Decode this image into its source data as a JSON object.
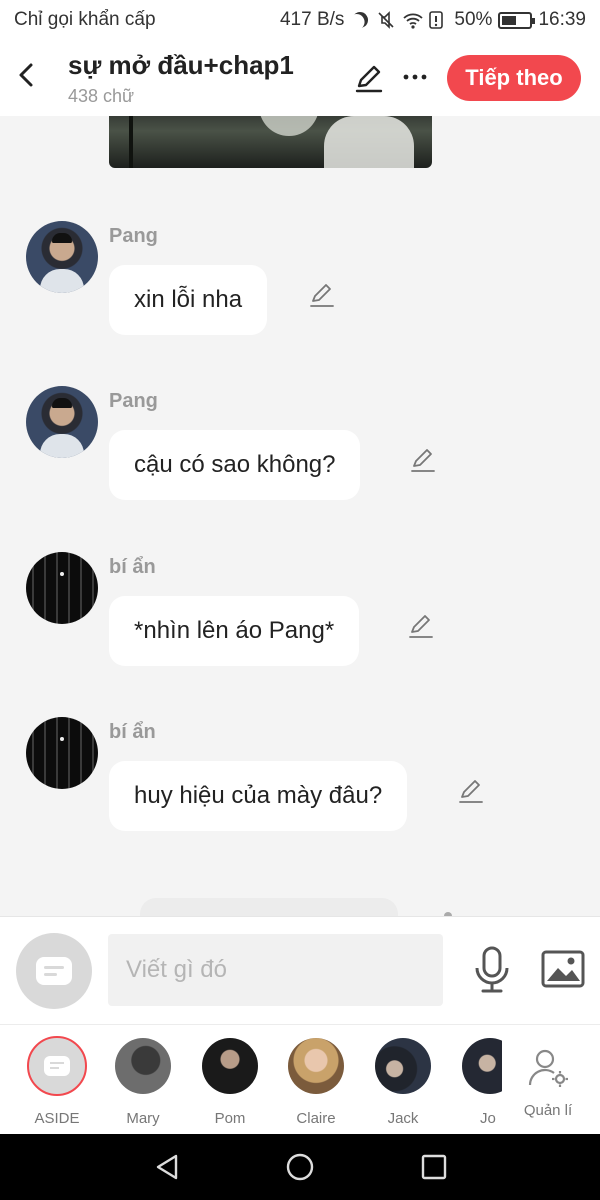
{
  "status_bar": {
    "carrier": "Chỉ gọi khẩn cấp",
    "speed": "417 B/s",
    "battery_pct": "50%",
    "time": "16:39"
  },
  "header": {
    "title": "sự mở đầu+chap1",
    "word_count": "438 chữ",
    "next_label": "Tiếp theo"
  },
  "messages": [
    {
      "sender": "Pang",
      "text": "xin lỗi nha",
      "avatar": "pang"
    },
    {
      "sender": "Pang",
      "text": "cậu có sao không?",
      "avatar": "pang"
    },
    {
      "sender": "bí ẩn",
      "text": "*nhìn lên áo Pang*",
      "avatar": "bian"
    },
    {
      "sender": "bí ẩn",
      "text": "huy hiệu của mày đâu?",
      "avatar": "bian"
    }
  ],
  "composer": {
    "placeholder": "Viết gì đó"
  },
  "characters": [
    {
      "label": "ASIDE"
    },
    {
      "label": "Mary"
    },
    {
      "label": "Pom"
    },
    {
      "label": "Claire"
    },
    {
      "label": "Jack"
    },
    {
      "label": "Jo"
    }
  ],
  "manage_label": "Quản lí",
  "colors": {
    "accent": "#f2484e",
    "background": "#f4f4f4"
  },
  "icons": [
    "back-icon",
    "pencil-icon",
    "more-icon",
    "mic-icon",
    "image-icon",
    "manage-icon",
    "nav-back-icon",
    "nav-home-icon",
    "nav-recent-icon"
  ]
}
